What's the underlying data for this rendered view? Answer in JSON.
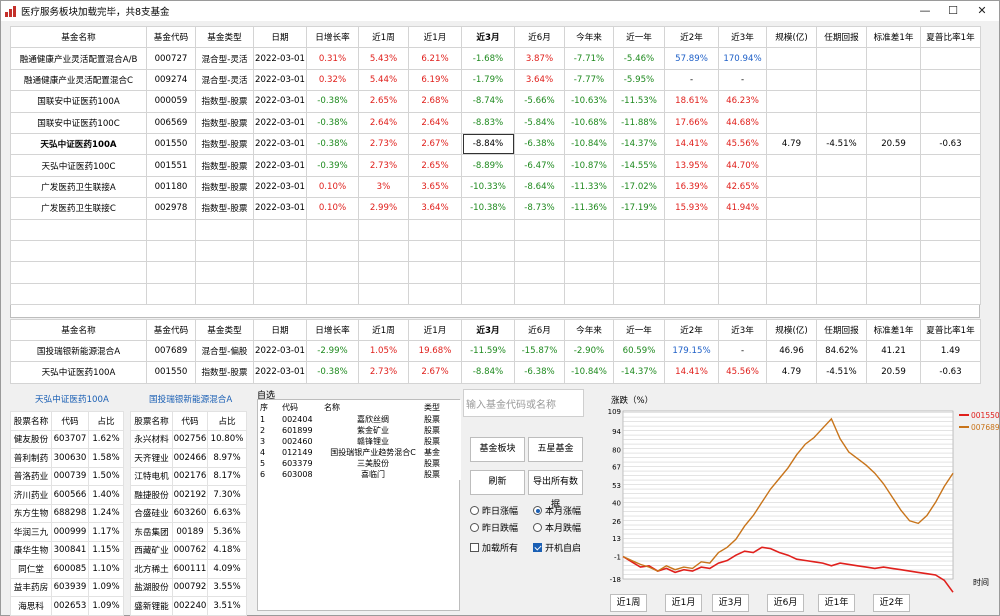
{
  "window": {
    "title": "医疗服务板块加载完毕，共8支基金",
    "btn_min": "—",
    "btn_max": "☐",
    "btn_close": "✕"
  },
  "table1": {
    "headers": [
      "基金名称",
      "基金代码",
      "基金类型",
      "日期",
      "日增长率",
      "近1周",
      "近1月",
      "近3月",
      "近6月",
      "今年来",
      "近一年",
      "近2年",
      "近3年",
      "规模(亿)",
      "任期回报",
      "标准差1年",
      "夏普比率1年"
    ],
    "rows": [
      {
        "cells": [
          "融通健康产业灵活配置混合A/B",
          "000727",
          "混合型-灵活",
          "2022-03-01",
          "0.31%",
          "5.43%",
          "6.21%",
          "-1.68%",
          "3.87%",
          "-7.71%",
          "-5.46%",
          "57.89%",
          "170.94%",
          "",
          "",
          "",
          ""
        ],
        "colors": [
          "k",
          "k",
          "k",
          "k",
          "r",
          "r",
          "r",
          "g",
          "r",
          "g",
          "g",
          "b",
          "b",
          "k",
          "k",
          "k",
          "k"
        ]
      },
      {
        "cells": [
          "融通健康产业灵活配置混合C",
          "009274",
          "混合型-灵活",
          "2022-03-01",
          "0.32%",
          "5.44%",
          "6.19%",
          "-1.79%",
          "3.64%",
          "-7.77%",
          "-5.95%",
          "-",
          "-",
          "",
          "",
          "",
          ""
        ],
        "colors": [
          "k",
          "k",
          "k",
          "k",
          "r",
          "r",
          "r",
          "g",
          "r",
          "g",
          "g",
          "k",
          "k",
          "k",
          "k",
          "k",
          "k"
        ]
      },
      {
        "cells": [
          "国联安中证医药100A",
          "000059",
          "指数型-股票",
          "2022-03-01",
          "-0.38%",
          "2.65%",
          "2.68%",
          "-8.74%",
          "-5.66%",
          "-10.63%",
          "-11.53%",
          "18.61%",
          "46.23%",
          "",
          "",
          "",
          ""
        ],
        "colors": [
          "k",
          "k",
          "k",
          "k",
          "g",
          "r",
          "r",
          "g",
          "g",
          "g",
          "g",
          "r",
          "r",
          "k",
          "k",
          "k",
          "k"
        ]
      },
      {
        "cells": [
          "国联安中证医药100C",
          "006569",
          "指数型-股票",
          "2022-03-01",
          "-0.38%",
          "2.64%",
          "2.64%",
          "-8.83%",
          "-5.84%",
          "-10.68%",
          "-11.88%",
          "17.66%",
          "44.68%",
          "",
          "",
          "",
          ""
        ],
        "colors": [
          "k",
          "k",
          "k",
          "k",
          "g",
          "r",
          "r",
          "g",
          "g",
          "g",
          "g",
          "r",
          "r",
          "k",
          "k",
          "k",
          "k"
        ]
      },
      {
        "cells": [
          "天弘中证医药100A",
          "001550",
          "指数型-股票",
          "2022-03-01",
          "-0.38%",
          "2.73%",
          "2.67%",
          "-8.84%",
          "-6.38%",
          "-10.84%",
          "-14.37%",
          "14.41%",
          "45.56%",
          "4.79",
          "-4.51%",
          "20.59",
          "-0.63"
        ],
        "colors": [
          "k",
          "k",
          "k",
          "k",
          "g",
          "r",
          "r",
          "k",
          "g",
          "g",
          "g",
          "r",
          "r",
          "k",
          "k",
          "k",
          "k"
        ],
        "bold": true
      },
      {
        "cells": [
          "天弘中证医药100C",
          "001551",
          "指数型-股票",
          "2022-03-01",
          "-0.39%",
          "2.73%",
          "2.65%",
          "-8.89%",
          "-6.47%",
          "-10.87%",
          "-14.55%",
          "13.95%",
          "44.70%",
          "",
          "",
          "",
          ""
        ],
        "colors": [
          "k",
          "k",
          "k",
          "k",
          "g",
          "r",
          "r",
          "g",
          "g",
          "g",
          "g",
          "r",
          "r",
          "k",
          "k",
          "k",
          "k"
        ]
      },
      {
        "cells": [
          "广发医药卫生联接A",
          "001180",
          "指数型-股票",
          "2022-03-01",
          "0.10%",
          "3%",
          "3.65%",
          "-10.33%",
          "-8.64%",
          "-11.33%",
          "-17.02%",
          "16.39%",
          "42.65%",
          "",
          "",
          "",
          ""
        ],
        "colors": [
          "k",
          "k",
          "k",
          "k",
          "r",
          "r",
          "r",
          "g",
          "g",
          "g",
          "g",
          "r",
          "r",
          "k",
          "k",
          "k",
          "k"
        ]
      },
      {
        "cells": [
          "广发医药卫生联接C",
          "002978",
          "指数型-股票",
          "2022-03-01",
          "0.10%",
          "2.99%",
          "3.64%",
          "-10.38%",
          "-8.73%",
          "-11.36%",
          "-17.19%",
          "15.93%",
          "41.94%",
          "",
          "",
          "",
          ""
        ],
        "colors": [
          "k",
          "k",
          "k",
          "k",
          "r",
          "r",
          "r",
          "g",
          "g",
          "g",
          "g",
          "r",
          "r",
          "k",
          "k",
          "k",
          "k"
        ]
      }
    ],
    "empty_rows": 4
  },
  "table2": {
    "headers": [
      "基金名称",
      "基金代码",
      "基金类型",
      "日期",
      "日增长率",
      "近1周",
      "近1月",
      "近3月",
      "近6月",
      "今年来",
      "近一年",
      "近2年",
      "近3年",
      "规模(亿)",
      "任期回报",
      "标准差1年",
      "夏普比率1年"
    ],
    "rows": [
      {
        "cells": [
          "国投瑞银新能源混合A",
          "007689",
          "混合型-偏股",
          "2022-03-01",
          "-2.99%",
          "1.05%",
          "19.68%",
          "-11.59%",
          "-15.87%",
          "-2.90%",
          "60.59%",
          "179.15%",
          "-",
          "46.96",
          "84.62%",
          "41.21",
          "1.49"
        ],
        "colors": [
          "k",
          "k",
          "k",
          "k",
          "g",
          "r",
          "r",
          "g",
          "g",
          "g",
          "g",
          "b",
          "k",
          "k",
          "k",
          "k",
          "k"
        ]
      },
      {
        "cells": [
          "天弘中证医药100A",
          "001550",
          "指数型-股票",
          "2022-03-01",
          "-0.38%",
          "2.73%",
          "2.67%",
          "-8.84%",
          "-6.38%",
          "-10.84%",
          "-14.37%",
          "14.41%",
          "45.56%",
          "4.79",
          "-4.51%",
          "20.59",
          "-0.63"
        ],
        "colors": [
          "k",
          "k",
          "k",
          "k",
          "g",
          "r",
          "r",
          "g",
          "g",
          "g",
          "g",
          "r",
          "r",
          "k",
          "k",
          "k",
          "k"
        ]
      }
    ]
  },
  "holdings_left": {
    "title": "天弘中证医药100A",
    "headers": [
      "股票名称",
      "代码",
      "占比"
    ],
    "rows": [
      [
        "健友股份",
        "603707",
        "1.62%"
      ],
      [
        "普利制药",
        "300630",
        "1.58%"
      ],
      [
        "普洛药业",
        "000739",
        "1.50%"
      ],
      [
        "济川药业",
        "600566",
        "1.40%"
      ],
      [
        "东方生物",
        "688298",
        "1.24%"
      ],
      [
        "华润三九",
        "000999",
        "1.17%"
      ],
      [
        "康华生物",
        "300841",
        "1.15%"
      ],
      [
        "同仁堂",
        "600085",
        "1.10%"
      ],
      [
        "益丰药房",
        "603939",
        "1.09%"
      ],
      [
        "海思科",
        "002653",
        "1.09%"
      ]
    ]
  },
  "holdings_right": {
    "title": "国投瑞银新能源混合A",
    "headers": [
      "股票名称",
      "代码",
      "占比"
    ],
    "rows": [
      [
        "永兴材料",
        "002756",
        "10.80%"
      ],
      [
        "天齐锂业",
        "002466",
        "8.97%"
      ],
      [
        "江特电机",
        "002176",
        "8.17%"
      ],
      [
        "融捷股份",
        "002192",
        "7.30%"
      ],
      [
        "合盛硅业",
        "603260",
        "6.63%"
      ],
      [
        "东岳集团",
        "00189",
        "5.36%"
      ],
      [
        "西藏矿业",
        "000762",
        "4.18%"
      ],
      [
        "北方稀土",
        "600111",
        "4.09%"
      ],
      [
        "盐湖股份",
        "000792",
        "3.55%"
      ],
      [
        "盛新锂能",
        "002240",
        "3.51%"
      ]
    ]
  },
  "selfsel": {
    "label": "自选",
    "headers": [
      "序",
      "代码",
      "名称",
      "类型"
    ],
    "rows": [
      [
        "1",
        "002404",
        "嘉欣丝绸",
        "股票"
      ],
      [
        "2",
        "601899",
        "紫金矿业",
        "股票"
      ],
      [
        "3",
        "002460",
        "赣锋锂业",
        "股票"
      ],
      [
        "4",
        "012149",
        "国投瑞银产业趋势混合C",
        "基金"
      ],
      [
        "5",
        "603379",
        "三美股份",
        "股票"
      ],
      [
        "6",
        "603008",
        "喜临门",
        "股票"
      ]
    ]
  },
  "search": {
    "placeholder": "输入基金代码或名称"
  },
  "buttons": {
    "fund_sector": "基金板块",
    "five_star": "五星基金",
    "refresh": "刷新",
    "export": "导出所有数据"
  },
  "options": {
    "yesterday_up": "昨日涨幅",
    "month_up": "本月涨幅",
    "yesterday_down": "昨日跌幅",
    "month_down": "本月跌幅",
    "load_all": "加载所有",
    "autostart": "开机自启",
    "selected_radio": "本月涨幅"
  },
  "chart_data": {
    "type": "line",
    "ylabel": "涨跌（%）",
    "xlabel": "时间",
    "yticks": [
      109,
      94,
      80,
      67,
      53,
      40,
      26,
      13,
      -1,
      -18
    ],
    "ylim": [
      -18,
      109
    ],
    "series": [
      {
        "name": "001550",
        "color": "#e0201c",
        "values": [
          -1,
          -5,
          -9,
          -8,
          -12,
          -10,
          -13,
          -11,
          -12,
          -9,
          -10,
          -6,
          -4,
          0,
          3,
          2,
          6,
          5,
          2,
          0,
          -3,
          -4,
          -5,
          -6,
          -8,
          -6,
          -7,
          -8,
          -9,
          -10,
          -9,
          -10,
          -11,
          -12,
          -13,
          -14,
          -15,
          -19,
          -28
        ]
      },
      {
        "name": "007689",
        "color": "#c8741a",
        "values": [
          -1,
          -4,
          -7,
          -9,
          -12,
          -8,
          -11,
          -9,
          -10,
          -5,
          -6,
          2,
          6,
          12,
          22,
          30,
          40,
          50,
          58,
          66,
          76,
          84,
          89,
          96,
          103,
          88,
          78,
          73,
          68,
          62,
          54,
          44,
          34,
          26,
          24,
          30,
          40,
          52,
          62
        ]
      }
    ],
    "periods": [
      "近1周",
      "近1月",
      "近3月",
      "近6月",
      "近1年",
      "近2年"
    ]
  }
}
